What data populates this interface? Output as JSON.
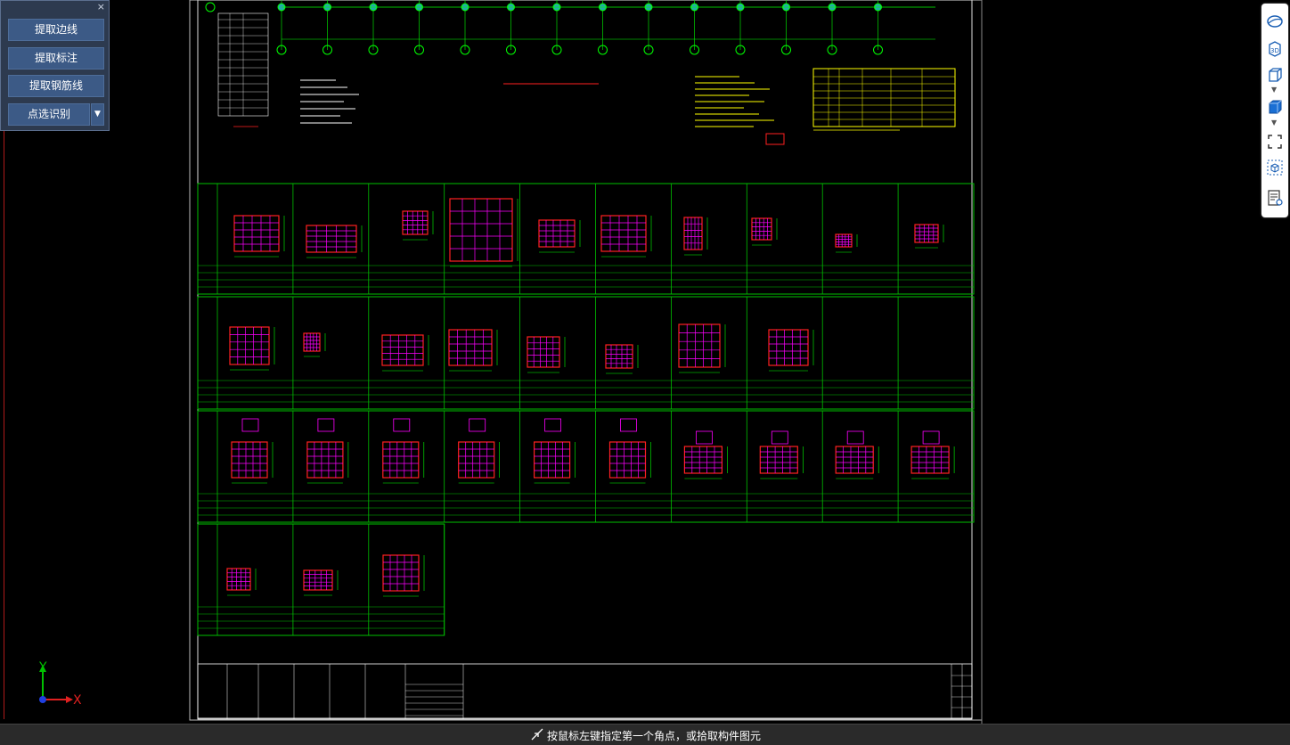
{
  "panel": {
    "close": "×",
    "buttons": [
      "提取边线",
      "提取标注",
      "提取钢筋线"
    ],
    "split_label": "点选识别",
    "split_arrow": "▼"
  },
  "toolbar": {
    "items": [
      "sphere-icon",
      "3d-view-icon",
      "box-outline-icon",
      "box-filled-icon",
      "fullscreen-icon",
      "cube-select-icon",
      "properties-icon"
    ],
    "label_3d": "3D"
  },
  "axes": {
    "y": "Y",
    "x": "X"
  },
  "status": {
    "message": "按鼠标左键指定第一个角点，或拾取构件图元"
  },
  "colors": {
    "background": "#000000",
    "grid": "#00c000",
    "rebar": "#ff00ff",
    "outline": "#ff2020",
    "dimension": "#00ff00",
    "note": "#ffff00",
    "panel": "#2d3a4f",
    "button": "#3c5a86"
  }
}
